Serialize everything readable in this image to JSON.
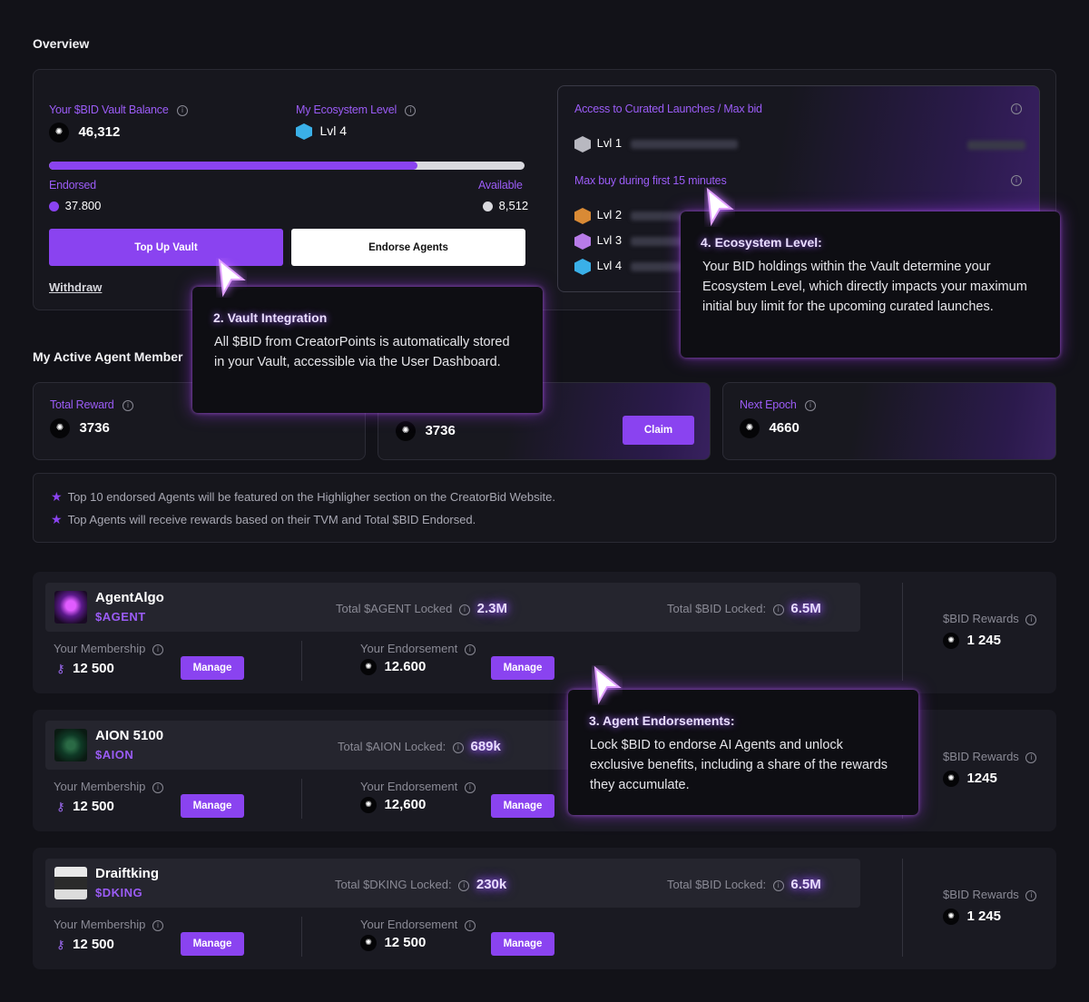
{
  "overview": {
    "title": "Overview",
    "vault_balance_label": "Your $BID Vault Balance",
    "vault_balance_value": "46,312",
    "eco_level_label": "My Ecosystem Level",
    "eco_level_value": "Lvl 4",
    "endorsed_fraction": 0.775,
    "endorsed_label": "Endorsed",
    "endorsed_value": "37.800",
    "available_label": "Available",
    "available_value": "8,512",
    "top_up_label": "Top Up Vault",
    "endorse_label": "Endorse Agents",
    "withdraw_label": "Withdraw"
  },
  "access": {
    "title": "Access to Curated Launches / Max bid",
    "lvl1": "Lvl 1",
    "max_buy_title": "Max buy during first 15 minutes",
    "lvl2": "Lvl 2",
    "lvl3": "Lvl 3",
    "lvl4": "Lvl 4"
  },
  "active": {
    "title": "My Active Agent Member",
    "total_reward_label": "Total Reward",
    "total_reward_value": "3736",
    "claimable_value": "3736",
    "claim_label": "Claim",
    "next_epoch_label": "Next Epoch",
    "next_epoch_value": "4660"
  },
  "notes": [
    "Top 10 endorsed Agents will be featured on the Highligher section on the CreatorBid Website.",
    "Top Agents will receive rewards based on their TVM and Total $BID Endorsed."
  ],
  "agents": [
    {
      "name": "AgentAlgo",
      "ticker": "$AGENT",
      "locked_label": "Total $AGENT Locked",
      "locked_value": "2.3M",
      "bid_locked_label": "Total $BID Locked:",
      "bid_locked_value": "6.5M",
      "membership_label": "Your Membership",
      "membership_value": "12 500",
      "endorsement_label": "Your Endorsement",
      "endorsement_value": "12.600",
      "manage_label": "Manage",
      "rewards_label": "$BID Rewards",
      "rewards_value": "1 245"
    },
    {
      "name": "AION 5100",
      "ticker": "$AION",
      "locked_label": "Total $AION Locked:",
      "locked_value": "689k",
      "membership_label": "Your Membership",
      "membership_value": "12 500",
      "endorsement_label": "Your Endorsement",
      "endorsement_value": "12,600",
      "manage_label": "Manage",
      "rewards_label": "$BID Rewards",
      "rewards_value": "1245"
    },
    {
      "name": "Draiftking",
      "ticker": "$DKING",
      "locked_label": "Total $DKING Locked:",
      "locked_value": "230k",
      "bid_locked_label": "Total $BID Locked:",
      "bid_locked_value": "6.5M",
      "membership_label": "Your Membership",
      "membership_value": "12 500",
      "endorsement_label": "Your Endorsement",
      "endorsement_value": "12 500",
      "manage_label": "Manage",
      "rewards_label": "$BID Rewards",
      "rewards_value": "1 245"
    }
  ],
  "tooltips": {
    "vault": {
      "title": "2. Vault Integration",
      "body": "All $BID from CreatorPoints is automatically stored in your Vault, accessible via the User Dashboard."
    },
    "eco": {
      "title": "4. Ecosystem Level:",
      "body": "Your BID holdings within the Vault determine your Ecosystem Level, which directly impacts your maximum initial buy limit for the upcoming curated launches."
    },
    "endorse": {
      "title": "3. Agent Endorsements:",
      "body": "Lock $BID to endorse AI Agents and unlock exclusive benefits, including a share of the rewards they accumulate."
    }
  },
  "colors": {
    "accent": "#8a43f0",
    "background": "#121218",
    "available_dot": "#d9d9de"
  },
  "icons": [
    "bid-token-icon",
    "info-icon",
    "star-icon",
    "key-icon",
    "level-badge-icon",
    "cursor-icon"
  ]
}
